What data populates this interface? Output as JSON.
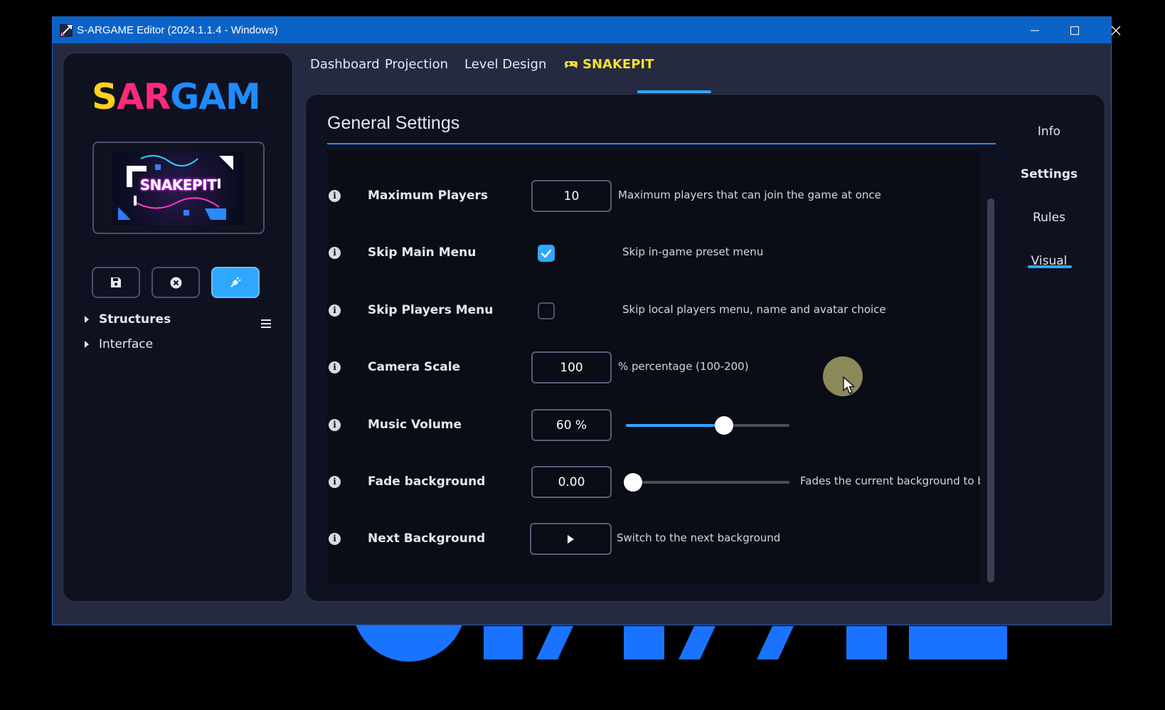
{
  "window": {
    "title": "S-ARGAME Editor (2024.1.1.4 - Windows)"
  },
  "sidebar": {
    "logo_text": "SARGAME",
    "thumbnail_title": "SNAKEPIT",
    "tools": [
      {
        "name": "save",
        "icon": "floppy-disk-icon"
      },
      {
        "name": "close",
        "icon": "close-circle-icon"
      },
      {
        "name": "connect",
        "icon": "plug-icon"
      }
    ],
    "tree": [
      {
        "label": "Structures"
      },
      {
        "label": "Interface"
      }
    ]
  },
  "tabs": [
    {
      "label": "Dashboard"
    },
    {
      "label": "Projection"
    },
    {
      "label": "Level Design"
    },
    {
      "label": "SNAKEPIT",
      "active": true,
      "icon": "gamepad-icon"
    }
  ],
  "panel": {
    "section_title": "General Settings",
    "right_nav": [
      {
        "label": "Info"
      },
      {
        "label": "Settings",
        "active": true
      },
      {
        "label": "Rules"
      },
      {
        "label": "Visual"
      }
    ],
    "settings": [
      {
        "label": "Maximum Players",
        "type": "number",
        "value": "10",
        "description": "Maximum players that can join the game at once"
      },
      {
        "label": "Skip Main Menu",
        "type": "checkbox",
        "checked": true,
        "description": "Skip in-game preset menu"
      },
      {
        "label": "Skip Players Menu",
        "type": "checkbox",
        "checked": false,
        "description": "Skip local players menu, name and avatar choice"
      },
      {
        "label": "Camera Scale",
        "type": "number",
        "value": "100",
        "description": "% percentage (100-200)"
      },
      {
        "label": "Music Volume",
        "type": "slider",
        "value": "60 %",
        "level": 0.6,
        "description": ""
      },
      {
        "label": "Fade background",
        "type": "slider",
        "value": "0.00",
        "level": 0.0,
        "description": "Fades the current background to bla"
      },
      {
        "label": "Next Background",
        "type": "button",
        "description": "Switch to the next background"
      }
    ]
  },
  "colors": {
    "accent": "#2ea8ff",
    "active_tab": "#f7e12a",
    "titlebar": "#0b63c8"
  }
}
